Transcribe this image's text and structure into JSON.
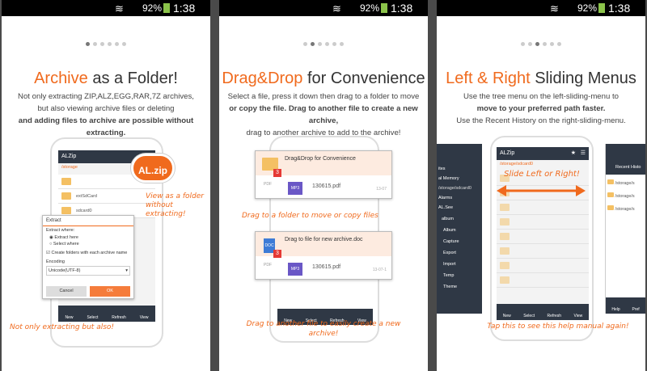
{
  "status": {
    "battery": "92%",
    "time": "1:38 PM"
  },
  "panel1": {
    "title_accent": "Archive",
    "title_rest": " as a Folder!",
    "desc": [
      "Not only extracting ZIP,ALZ,EGG,RAR,7Z archives,",
      "but also viewing archive files or deleting",
      "and adding files to archive are possible without extracting."
    ],
    "app_title": "ALZip",
    "path": "/storage",
    "badge": "AL.zip",
    "rows": [
      "extSdCard",
      "sdcard0"
    ],
    "dialog": {
      "title": "Extract",
      "where_label": "Extract where:",
      "opt1": "Extract here",
      "opt2": "Select where",
      "check": "Create folders with each archive name",
      "enc_label": "Encoding",
      "enc_value": "Unicode(UTF-8)",
      "cancel": "Cancel",
      "ok": "OK"
    },
    "bottom": [
      "New",
      "Select",
      "Refresh",
      "View"
    ],
    "note1": "View as a folder without extracting!",
    "note2": "Not only extracting but also!"
  },
  "panel2": {
    "title_accent": "Drag&Drop",
    "title_rest": " for Convenience",
    "desc1": "Select a file, press it down then drag to a folder to move",
    "desc2": "or copy the file. Drag to another file to create a new archive,",
    "desc3": "drag to another archive to add to the archive!",
    "card1_title": "Drag&Drop for Convenience",
    "card1_file": "130615.pdf",
    "card1_date": "13-07",
    "card2_title": "Drag to file for new archive.doc",
    "card2_file": "130615.pdf",
    "card2_date": "13-07-1",
    "badge_num": "3",
    "pdf": "PDF",
    "doc": "DOC",
    "mp3": "MP3",
    "note1": "Drag to a folder to move or copy files",
    "note2": "Drag to another file to easily create a new archive!",
    "bottom": [
      "New",
      "Select",
      "Refresh",
      "View"
    ]
  },
  "panel3": {
    "title_accent": "Left & Right",
    "title_rest": " Sliding Menus",
    "desc1": "Use the tree menu on the left-sliding-menu to",
    "desc2": "move to your preferred path faster.",
    "desc3": "Use the Recent History on the right-sliding-menu.",
    "app_title": "ALZip",
    "path": "/storage/sdcard0",
    "left_menu": [
      "ites",
      "al Memory",
      "/storage/sdcard0",
      "Alarms",
      "",
      "AL.See",
      "album",
      "Album",
      "Capture",
      "Export",
      "Import",
      "Temp",
      "Theme"
    ],
    "right_title": "Recent Histo",
    "right_items": [
      "/storage/s",
      "/storage/s",
      "/storage/s"
    ],
    "slide_note": "Slide Left or Right!",
    "note": "Tap this to see this help manual again!",
    "bottom": [
      "New",
      "Select",
      "Refresh",
      "View"
    ],
    "bottom_right": [
      "Help",
      "Pref"
    ]
  }
}
